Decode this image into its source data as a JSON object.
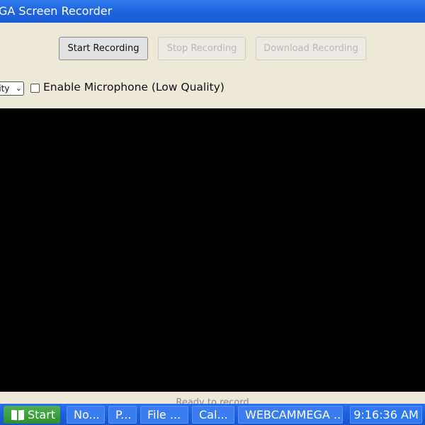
{
  "window": {
    "title": "GA Screen Recorder"
  },
  "toolbar": {
    "start_label": "Start Recording",
    "stop_label": "Stop Recording",
    "download_label": "Download Recording"
  },
  "options": {
    "quality_select_value": "lity",
    "mic_checked": false,
    "mic_label": "Enable Microphone (Low Quality)"
  },
  "status": {
    "text": "Ready to record"
  },
  "taskbar": {
    "start_label": "Start",
    "tasks": [
      {
        "label": "No..."
      },
      {
        "label": "P..."
      },
      {
        "label": "File ..."
      },
      {
        "label": "Cal..."
      },
      {
        "label": "WEBCAMMEGA ..."
      }
    ],
    "clock": "9:16:36 AM"
  },
  "colors": {
    "titlebar": "#1f66e0",
    "taskbar": "#1d5fdc",
    "start_button": "#3a9a3a",
    "window_bg": "#ece9d8",
    "preview_bg": "#000000"
  }
}
